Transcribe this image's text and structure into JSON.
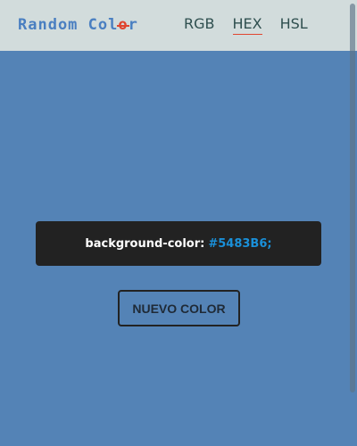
{
  "app": {
    "logo_prefix": "Random Col",
    "logo_accent": "o",
    "logo_suffix": "r"
  },
  "nav": {
    "items": [
      {
        "label": "RGB",
        "active": false
      },
      {
        "label": "HEX",
        "active": true
      },
      {
        "label": "HSL",
        "active": false
      }
    ]
  },
  "display": {
    "property_label": "background-color:",
    "value_text": "#5483B6;"
  },
  "actions": {
    "new_color_label": "NUEVO COLOR"
  },
  "colors": {
    "background": "#5483B6",
    "topbar": "#D2DCDC",
    "logo": "#4A7FC1",
    "accent": "#E0462F",
    "card": "#222222",
    "value_text": "#1A90D9"
  }
}
